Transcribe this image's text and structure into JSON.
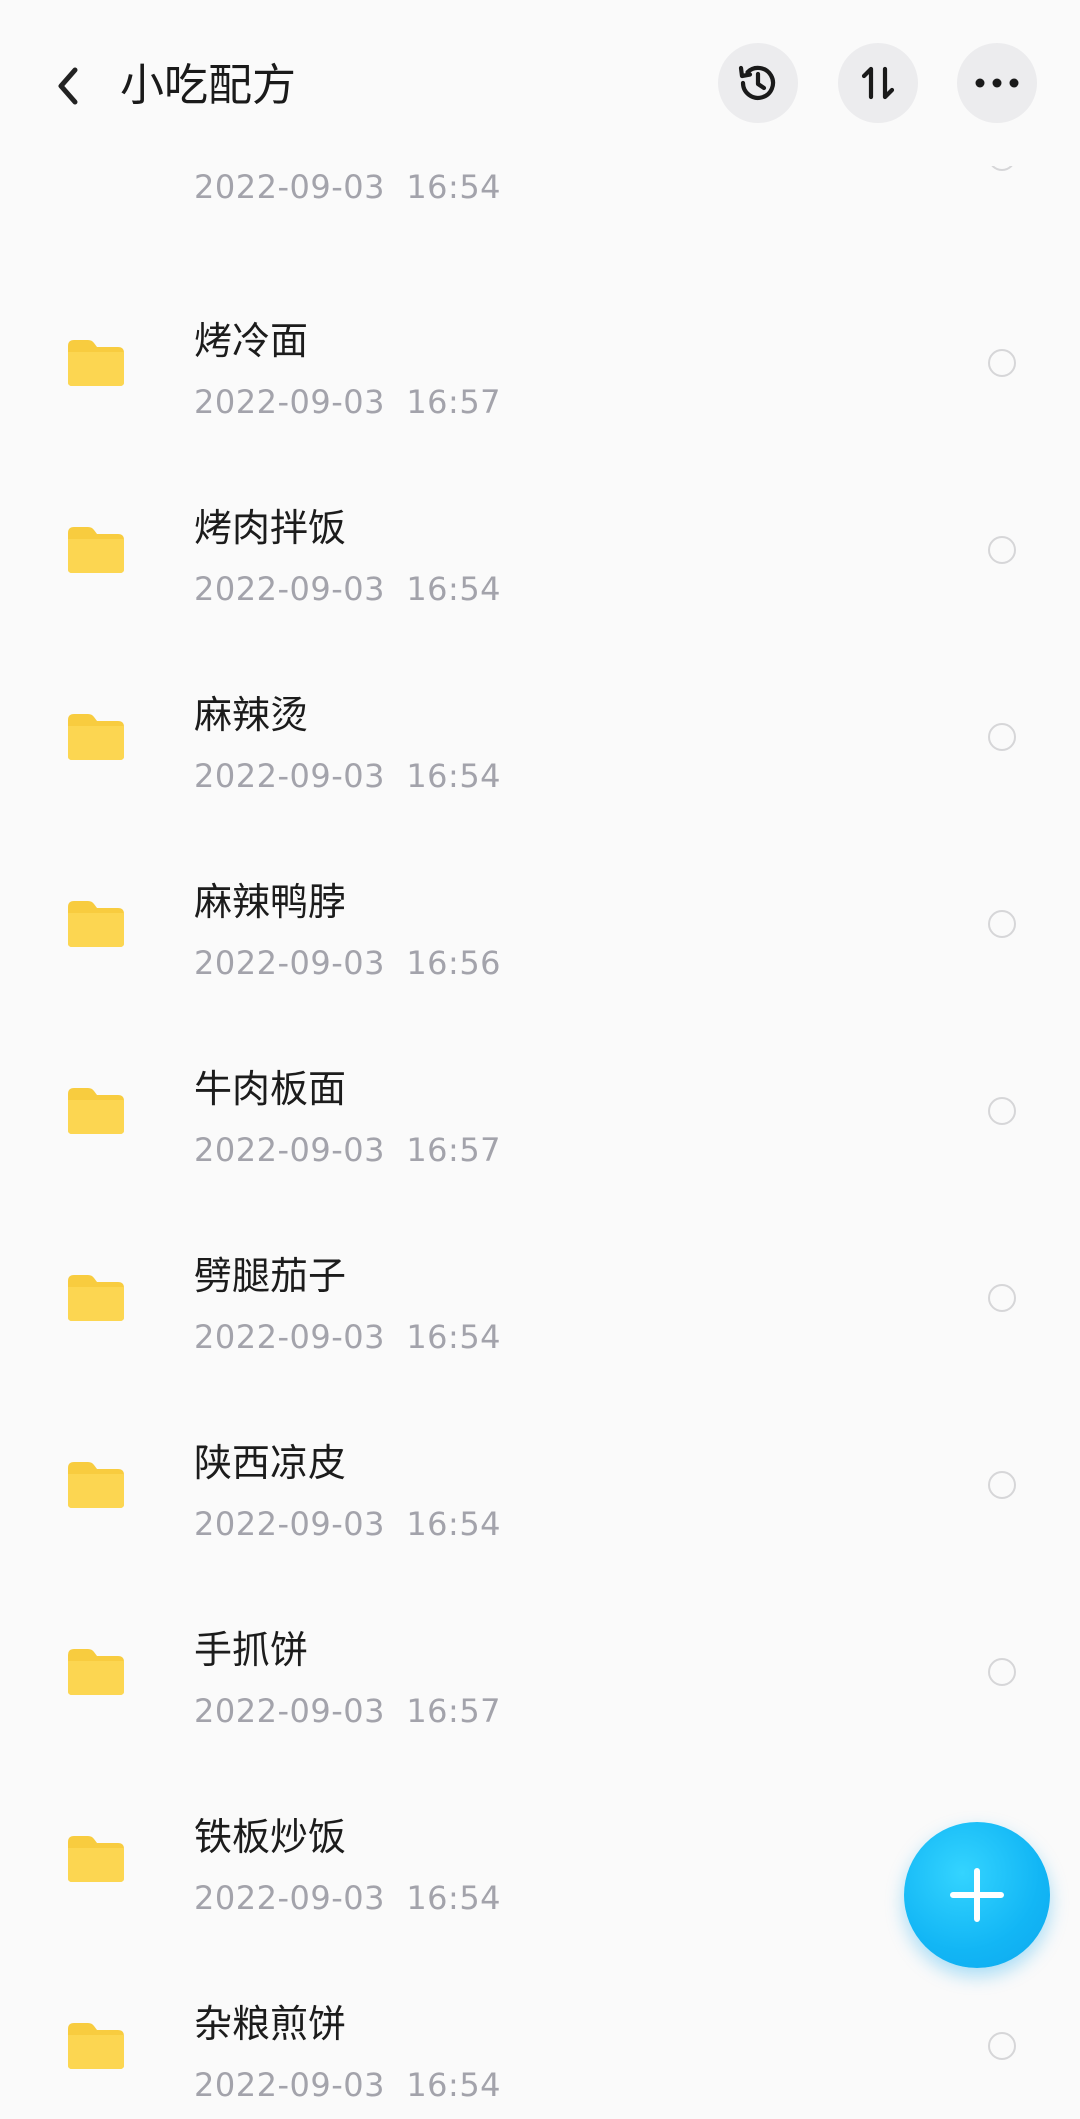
{
  "header": {
    "title": "小吃配方"
  },
  "folders": [
    {
      "name": "",
      "date": "2022-09-03  16:54"
    },
    {
      "name": "烤冷面",
      "date": "2022-09-03  16:57"
    },
    {
      "name": "烤肉拌饭",
      "date": "2022-09-03  16:54"
    },
    {
      "name": "麻辣烫",
      "date": "2022-09-03  16:54"
    },
    {
      "name": "麻辣鸭脖",
      "date": "2022-09-03  16:56"
    },
    {
      "name": "牛肉板面",
      "date": "2022-09-03  16:57"
    },
    {
      "name": "劈腿茄子",
      "date": "2022-09-03  16:54"
    },
    {
      "name": "陕西凉皮",
      "date": "2022-09-03  16:54"
    },
    {
      "name": "手抓饼",
      "date": "2022-09-03  16:57"
    },
    {
      "name": "铁板炒饭",
      "date": "2022-09-03  16:54"
    },
    {
      "name": "杂粮煎饼",
      "date": "2022-09-03  16:54"
    }
  ],
  "icons": {
    "back": "chevron-left-icon",
    "history": "history-icon",
    "sort": "sort-icon",
    "more": "more-icon",
    "folder": "folder-icon",
    "add": "plus-icon"
  },
  "colors": {
    "folder": "#fcd34d",
    "accent": "#12b6f5",
    "date_text": "#a3a3ab"
  }
}
